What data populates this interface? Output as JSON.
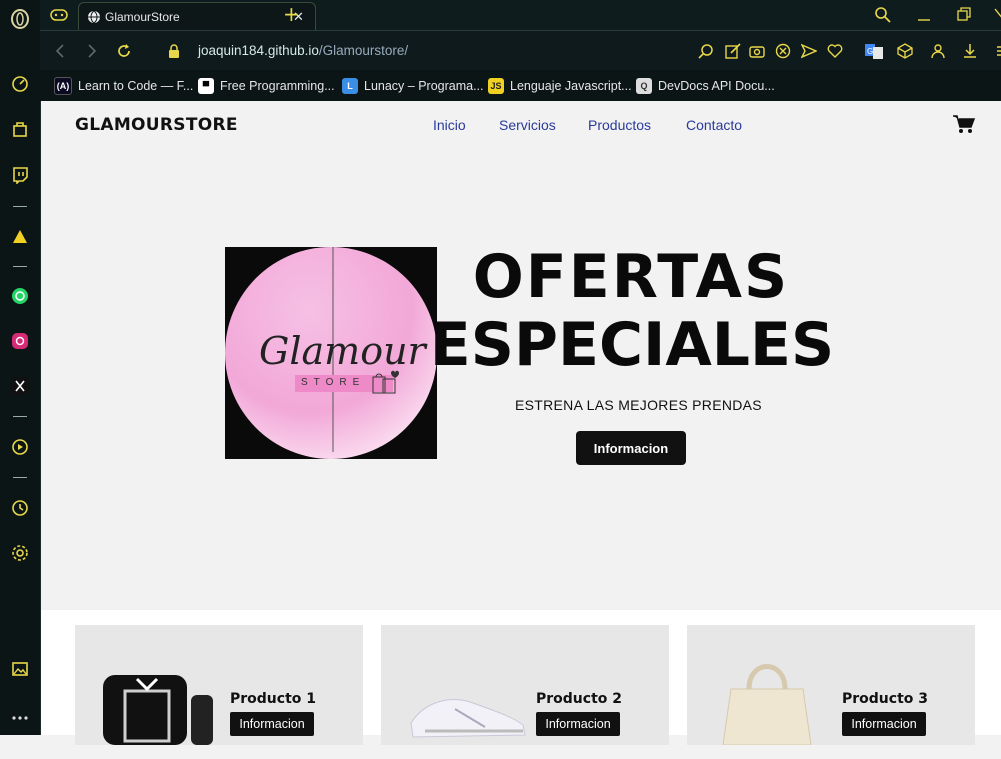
{
  "browser": {
    "tab": {
      "title": "GlamourStore",
      "close": "✕"
    },
    "new_tab": "+",
    "url": {
      "domain": "joaquin184.github.io",
      "path": "/Glamourstore/"
    },
    "bookmarks": [
      {
        "label": "Learn to Code — F...",
        "icon": "freecodecamp-icon",
        "fav": "(A)"
      },
      {
        "label": "Free Programming...",
        "icon": "book-icon",
        "fav": "▀"
      },
      {
        "label": "Lunacy – Programa...",
        "icon": "lunacy-icon",
        "fav": "L"
      },
      {
        "label": "Lenguaje Javascript...",
        "icon": "js-icon",
        "fav": "JS"
      },
      {
        "label": "DevDocs API Docu...",
        "icon": "devdocs-icon",
        "fav": "Q"
      }
    ]
  },
  "site": {
    "brand": "GLAMOURSTORE",
    "nav": [
      "Inicio",
      "Servicios",
      "Productos",
      "Contacto"
    ],
    "hero": {
      "title_line1": "OFERTAS",
      "title_line2": "ESPECIALES",
      "subtitle": "ESTRENA LAS MEJORES PRENDAS",
      "button": "Informacion",
      "logo_text": "Glamour",
      "logo_sub": "STORE"
    },
    "products": [
      {
        "name": "Producto 1",
        "button": "Informacion",
        "image": "belt-image"
      },
      {
        "name": "Producto 2",
        "button": "Informacion",
        "image": "sneaker-image"
      },
      {
        "name": "Producto 3",
        "button": "Informacion",
        "image": "bag-image"
      }
    ]
  },
  "colors": {
    "accent": "#e8d84a",
    "nav_link": "#2a3a9a",
    "button": "#111111",
    "logo_pink": "#e78ac8"
  }
}
